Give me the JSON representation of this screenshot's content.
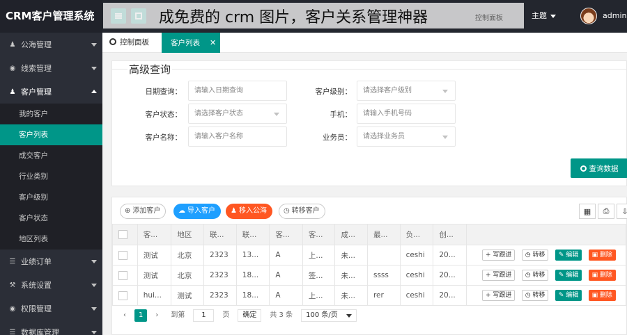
{
  "app": {
    "title": "CRM客户管理系统"
  },
  "watermark": "成免费的 crm 图片，客户关系管理神器",
  "header": {
    "dashboard": "控制面板",
    "theme": "主题",
    "user": "admin"
  },
  "sidebar": {
    "items": [
      {
        "label": "公海管理",
        "icon": "user-icon"
      },
      {
        "label": "线索管理",
        "icon": "globe-icon"
      },
      {
        "label": "客户管理",
        "icon": "user-icon"
      },
      {
        "label": "业绩订单",
        "icon": "database-icon"
      },
      {
        "label": "系统设置",
        "icon": "wrench-icon"
      },
      {
        "label": "权限管理",
        "icon": "globe-icon"
      },
      {
        "label": "数据库管理",
        "icon": "database-icon"
      }
    ],
    "submenu": [
      "我的客户",
      "客户列表",
      "成交客户",
      "行业类别",
      "客户级别",
      "客户状态",
      "地区列表"
    ]
  },
  "tabs": {
    "home": "控制面板",
    "current": "客户列表",
    "close": "✕"
  },
  "search": {
    "title": "高级查询",
    "fields": {
      "date_label": "日期查询：",
      "date_ph": "请输入日期查询",
      "level_label": "客户级别：",
      "level_ph": "请选择客户级别",
      "status_label": "客户状态：",
      "status_ph": "请选择客户状态",
      "phone_label": "手机：",
      "phone_ph": "请输入手机号码",
      "name_label": "客户名称：",
      "name_ph": "请输入客户名称",
      "sales_label": "业务员：",
      "sales_ph": "请选择业务员"
    },
    "submit": "查询数据"
  },
  "toolbar": {
    "add": "添加客户",
    "import": "导入客户",
    "to_pool": "移入公海",
    "transfer": "转移客户"
  },
  "table": {
    "headers": [
      "客...",
      "地区",
      "联...",
      "联...",
      "客...",
      "客...",
      "成...",
      "最...",
      "负...",
      "创..."
    ],
    "rows": [
      [
        "测试",
        "北京",
        "2323",
        "13...",
        "A",
        "上...",
        "未...",
        "",
        "ceshi",
        "20..."
      ],
      [
        "测试",
        "北京",
        "2323",
        "18...",
        "A",
        "签...",
        "未...",
        "ssss",
        "ceshi",
        "20..."
      ],
      [
        "hui...",
        "测试",
        "2323",
        "18...",
        "A",
        "上...",
        "未...",
        "rer",
        "ceshi",
        "20..."
      ]
    ],
    "actions": {
      "follow": "+ 写跟进",
      "transfer": "◷ 转移",
      "edit": "✎ 编辑",
      "delete": "▣ 删除"
    }
  },
  "pager": {
    "prev": "‹",
    "page": "1",
    "next": "›",
    "goto": "到第",
    "input": "1",
    "page_unit": "页",
    "confirm": "确定",
    "total": "共 3 条",
    "per_page": "100 条/页"
  }
}
